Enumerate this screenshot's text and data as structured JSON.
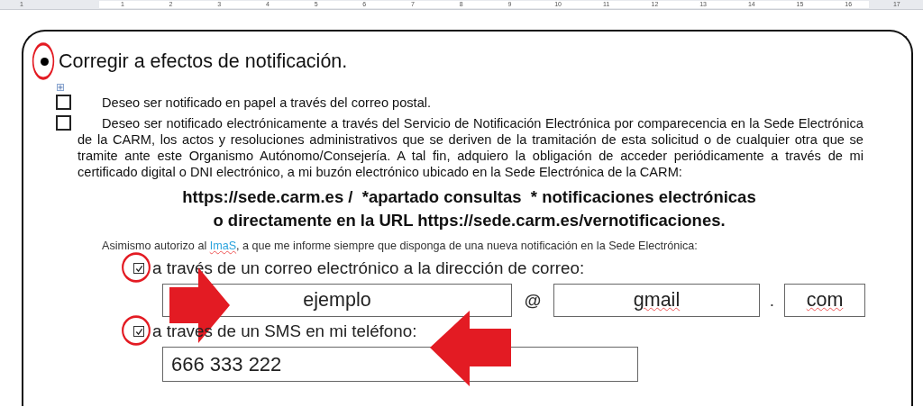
{
  "ruler": {
    "labels": [
      "1",
      "1",
      "2",
      "3",
      "4",
      "5",
      "6",
      "7",
      "8",
      "9",
      "10",
      "11",
      "12",
      "13",
      "14",
      "15",
      "16",
      "17"
    ]
  },
  "section": {
    "heading": "Corregir a efectos de notificación.",
    "circled": true,
    "options": [
      {
        "kind": "box",
        "checked": false,
        "text": "Deseo ser notificado en papel a través del correo postal."
      },
      {
        "kind": "box",
        "checked": false,
        "text": "Deseo ser notificado electrónicamente a través del Servicio de Notificación Electrónica por comparecencia en la Sede Electrónica de la CARM, los actos y resoluciones administrativos que se deriven de la tramitación de esta solicitud o de cualquier otra que se tramite ante este Organismo Autónomo/Consejería. A tal fin, adquiero la obligación de acceder periódicamente a través de mi certificado digital o DNI electrónico, a mi buzón electrónico ubicado en la Sede Electrónica de la CARM:"
      }
    ],
    "links": [
      "https://sede.carm.es /  *apartado consultas  * notificaciones electrónicas",
      "o directamente en la URL https://sede.carm.es/vernotificaciones."
    ],
    "authorize": {
      "before": "Asimismo autorizo al ",
      "org": "ImaS",
      "after": ", a que me informe siempre que disponga de una nueva notificación en la Sede Electrónica:"
    },
    "email": {
      "checked": true,
      "circled": true,
      "label": "a través de un correo electrónico a la dirección de correo:",
      "user": "ejemplo",
      "pointed": true,
      "at": "@",
      "domain": "gmail",
      "dot": ".",
      "tld": "com"
    },
    "sms": {
      "checked": true,
      "circled": true,
      "label": "a traves de un SMS en mi teléfono:",
      "phone": "666 333 222",
      "pointed": true
    }
  }
}
